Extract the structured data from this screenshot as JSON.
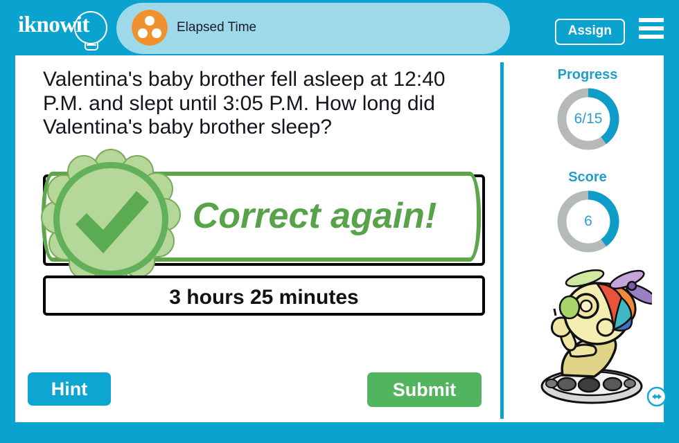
{
  "header": {
    "logo_text": "iknowit",
    "logo_icon": "lightbulb-icon",
    "topic_icon": "three-dots-circle-icon",
    "topic_label": "Elapsed Time",
    "assign_label": "Assign",
    "menu_icon": "hamburger-menu-icon"
  },
  "question": {
    "text": "Valentina's baby brother fell asleep at 12:40 P.M. and slept until 3:05 P.M. How long did Valentina's baby brother sleep?"
  },
  "feedback": {
    "message": "Correct again!",
    "seal_icon": "checkmark-seal-icon",
    "state": "correct"
  },
  "answer": {
    "value": "3 hours 25 minutes"
  },
  "actions": {
    "hint_label": "Hint",
    "submit_label": "Submit"
  },
  "rail": {
    "progress_label": "Progress",
    "progress_value": "6/15",
    "progress_current": 6,
    "progress_total": 15,
    "progress_percent": 40,
    "score_label": "Score",
    "score_value": "6",
    "score_percent": 40,
    "mascot_icon": "alien-mascot-icon",
    "resize_icon": "horizontal-resize-icon"
  },
  "colors": {
    "frame_blue": "#0aa3cf",
    "pill_blue": "#9ed9ea",
    "accent_orange": "#f0912f",
    "correct_green": "#58a24a",
    "submit_green": "#52b45f",
    "ring_track": "#b6b9ba",
    "ring_fill": "#0e9dc9"
  }
}
